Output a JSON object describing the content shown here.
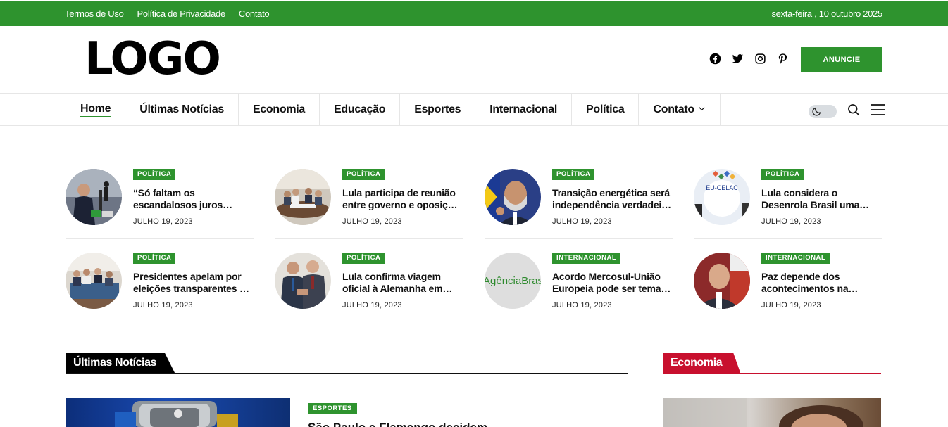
{
  "topbar": {
    "links": [
      "Termos de Uso",
      "Política de Privacidade",
      "Contato"
    ],
    "date": "sexta-feira , 10 outubro 2025"
  },
  "header": {
    "logo": "LOGO",
    "socials": [
      "facebook-icon",
      "twitter-icon",
      "instagram-icon",
      "pinterest-icon"
    ],
    "anuncie": "ANUNCIE"
  },
  "nav": {
    "items": [
      "Home",
      "Últimas Notícias",
      "Economia",
      "Educação",
      "Esportes",
      "Internacional",
      "Política",
      "Contato"
    ],
    "active": "Home"
  },
  "posts": [
    {
      "cat": "POLÍTICA",
      "l1": "“Só faltam os",
      "l2": "escandalosos juros…",
      "date": "JULHO 19, 2023"
    },
    {
      "cat": "POLÍTICA",
      "l1": "Lula participa de reunião",
      "l2": "entre governo e oposiçã…",
      "date": "JULHO 19, 2023"
    },
    {
      "cat": "POLÍTICA",
      "l1": "Transição energética será",
      "l2": "independência verdadei…",
      "date": "JULHO 19, 2023"
    },
    {
      "cat": "POLÍTICA",
      "l1": "Lula considera o",
      "l2": "Desenrola Brasil uma…",
      "date": "JULHO 19, 2023"
    },
    {
      "cat": "POLÍTICA",
      "l1": "Presidentes apelam por",
      "l2": "eleições transparentes …",
      "date": "JULHO 19, 2023"
    },
    {
      "cat": "POLÍTICA",
      "l1": "Lula confirma viagem",
      "l2": "oficial à Alemanha em…",
      "date": "JULHO 19, 2023"
    },
    {
      "cat": "INTERNACIONAL",
      "l1": "Acordo Mercosul-União",
      "l2": "Europeia pode ser tema…",
      "date": "JULHO 19, 2023"
    },
    {
      "cat": "INTERNACIONAL",
      "l1": "Paz depende dos",
      "l2": "acontecimentos na…",
      "date": "JULHO 19, 2023"
    }
  ],
  "thumbs": {
    "p3_text": "EU-CELAC",
    "p7_text": "AgênciaBrasil"
  },
  "sections": {
    "latest": "Últimas Notícias",
    "economy": "Economia"
  },
  "featured": {
    "cat": "ESPORTES",
    "title": "São Paulo e Flamengo decidem"
  },
  "colors": {
    "brand": "#2e932e",
    "section_dark": "#000000",
    "section_red": "#c8102e"
  }
}
